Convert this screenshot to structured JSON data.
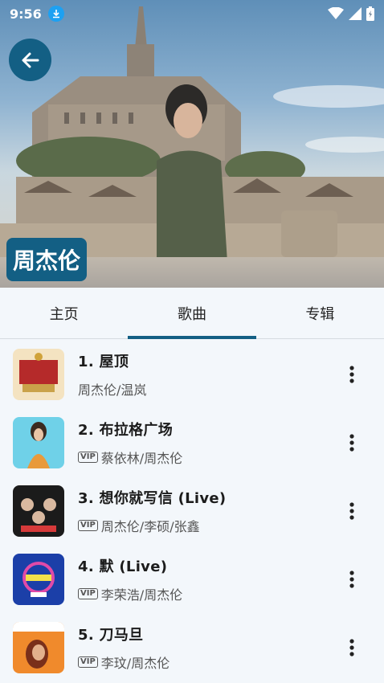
{
  "status": {
    "time": "9:56"
  },
  "artist": {
    "name": "周杰伦"
  },
  "tabs": [
    {
      "label": "主页",
      "active": false
    },
    {
      "label": "歌曲",
      "active": true
    },
    {
      "label": "专辑",
      "active": false
    }
  ],
  "songs": [
    {
      "title": "1. 屋顶",
      "artists": "周杰伦/温岚",
      "vip": false,
      "thumb_colors": [
        "#f4e3c1",
        "#b52a2a"
      ]
    },
    {
      "title": "2. 布拉格广场",
      "artists": "蔡依林/周杰伦",
      "vip": true,
      "thumb_colors": [
        "#6fd1e8",
        "#e89a3b"
      ]
    },
    {
      "title": "3. 想你就写信 (Live)",
      "artists": "周杰伦/李硕/张鑫",
      "vip": true,
      "thumb_colors": [
        "#1b1b1b",
        "#d63a3a"
      ]
    },
    {
      "title": "4. 默 (Live)",
      "artists": "李荣浩/周杰伦",
      "vip": true,
      "thumb_colors": [
        "#1b3fa8",
        "#e04aa8"
      ]
    },
    {
      "title": "5. 刀马旦",
      "artists": "李玟/周杰伦",
      "vip": true,
      "thumb_colors": [
        "#f08a2c",
        "#7a2f1a"
      ]
    }
  ],
  "labels": {
    "vip": "VIP"
  },
  "colors": {
    "accent": "#135f84"
  }
}
